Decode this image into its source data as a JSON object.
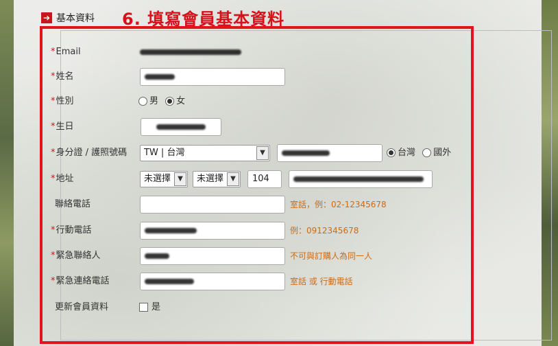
{
  "section": {
    "icon": "arrow-right-icon",
    "title": "基本資料"
  },
  "step_title": "6. 填寫會員基本資料",
  "form": {
    "email": {
      "label": "Email",
      "value": ""
    },
    "name": {
      "label": "姓名"
    },
    "gender": {
      "label": "性別",
      "options": [
        "男",
        "女"
      ],
      "selected": "女"
    },
    "birthday": {
      "label": "生日"
    },
    "id_doc": {
      "label": "身分證 / 護照號碼",
      "country_select": "TW | 台灣",
      "region_options": [
        "台灣",
        "國外"
      ],
      "region_selected": "台灣"
    },
    "address": {
      "label": "地址",
      "city_select": "未選擇",
      "district_select": "未選擇",
      "zip": "104"
    },
    "phone": {
      "label": "聯絡電話",
      "hint": "室話，例：02-12345678",
      "value": ""
    },
    "mobile": {
      "label": "行動電話",
      "hint": "例：0912345678"
    },
    "emergency_contact": {
      "label": "緊急聯絡人",
      "hint": "不可與訂購人為同一人"
    },
    "emergency_phone": {
      "label": "緊急連絡電話",
      "hint": "室話 或 行動電話"
    },
    "update_member": {
      "label": "更新會員資料",
      "checkbox_label": "是"
    }
  },
  "colors": {
    "accent_red": "#d8101b",
    "hint_orange": "#c86c1a"
  }
}
